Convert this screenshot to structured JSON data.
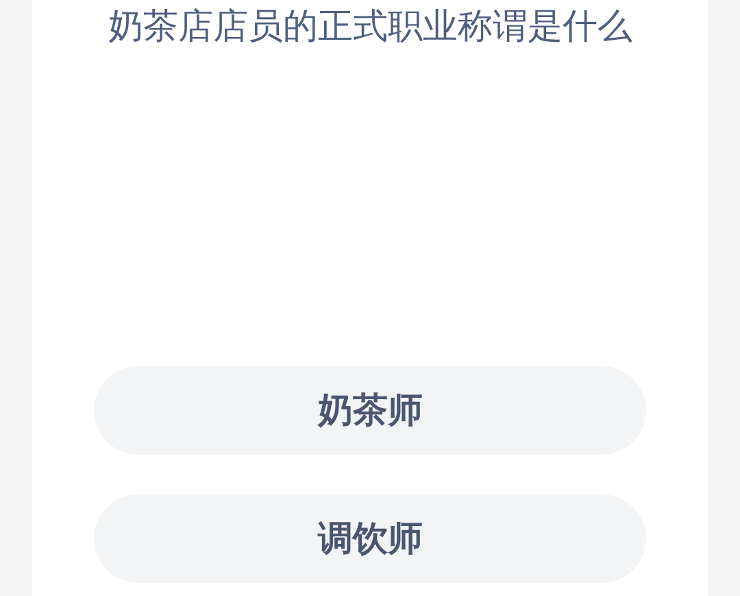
{
  "question": "奶茶店店员的正式职业称谓是什么",
  "options": [
    {
      "label": "奶茶师"
    },
    {
      "label": "调饮师"
    }
  ]
}
